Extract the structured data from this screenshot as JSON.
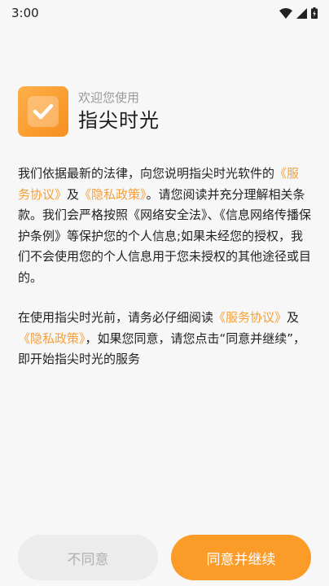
{
  "status_bar": {
    "time": "3:00"
  },
  "header": {
    "welcome": "欢迎您使用",
    "app_name": "指尖时光"
  },
  "paragraph1": {
    "t1": "我们依据最新的法律，向您说明指尖时光软件的",
    "link_service": "《服务协议》",
    "t2": "及",
    "link_privacy": "《隐私政策》",
    "t3": "。请您阅读并充分理解相关条款。我们会严格按照《网络安全法》、《信息网络传播保护条例》等保护您的个人信息;如果未经您的授权，我们不会使用您的个人信息用于您未授权的其他途径或目的。"
  },
  "paragraph2": {
    "t1": "在使用指尖时光前，请务必仔细阅读",
    "link_service": "《服务协议》",
    "t2": "及",
    "link_privacy": "《隐私政策》",
    "t3": "，如果您同意，请您点击“同意并继续”，即开始指尖时光的服务"
  },
  "buttons": {
    "disagree": "不同意",
    "agree": "同意并继续"
  },
  "colors": {
    "accent": "#fb9b28",
    "link": "#f5a03a",
    "disabled_bg": "#ececec"
  }
}
